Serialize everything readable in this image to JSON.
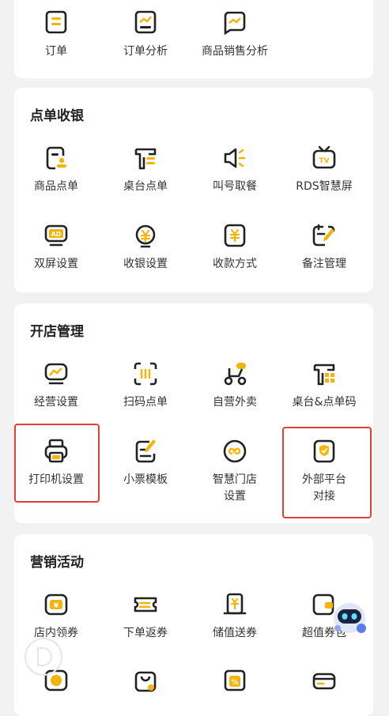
{
  "colors": {
    "accent": "#f5b40a",
    "stroke": "#222222",
    "highlight": "#e0403a"
  },
  "top": {
    "items": [
      {
        "label": "订单",
        "icon": "order-icon"
      },
      {
        "label": "订单分析",
        "icon": "order-analysis-icon"
      },
      {
        "label": "商品销售分析",
        "icon": "sales-analysis-icon"
      }
    ]
  },
  "checkout": {
    "title": "点单收银",
    "items": [
      {
        "label": "商品点单",
        "icon": "goods-order-icon"
      },
      {
        "label": "桌台点单",
        "icon": "table-order-icon"
      },
      {
        "label": "叫号取餐",
        "icon": "speaker-icon"
      },
      {
        "label": "RDS智慧屏",
        "icon": "tv-icon"
      },
      {
        "label": "双屏设置",
        "icon": "ad-screen-icon"
      },
      {
        "label": "收银设置",
        "icon": "cashier-icon"
      },
      {
        "label": "收款方式",
        "icon": "payment-icon"
      },
      {
        "label": "备注管理",
        "icon": "note-icon"
      }
    ]
  },
  "store": {
    "title": "开店管理",
    "items": [
      {
        "label": "经营设置",
        "icon": "business-icon"
      },
      {
        "label": "扫码点单",
        "icon": "scan-icon"
      },
      {
        "label": "自营外卖",
        "icon": "scooter-icon"
      },
      {
        "label": "桌台&点单码",
        "icon": "table-qr-icon"
      },
      {
        "label": "打印机设置",
        "icon": "printer-icon"
      },
      {
        "label": "小票模板",
        "icon": "receipt-icon"
      },
      {
        "label_1": "智慧门店",
        "label_2": "设置",
        "icon": "smart-store-icon"
      },
      {
        "label_1": "外部平台",
        "label_2": "对接",
        "icon": "shield-icon"
      }
    ]
  },
  "marketing": {
    "title": "营销活动",
    "items": [
      {
        "label": "店内领券",
        "icon": "coupon-icon"
      },
      {
        "label": "下单返券",
        "icon": "ticket-icon"
      },
      {
        "label": "储值送券",
        "icon": "stored-value-icon"
      },
      {
        "label": "超值券包",
        "icon": "coupon-pack-icon"
      },
      {
        "icon": "coin-icon"
      },
      {
        "icon": "bag-icon"
      },
      {
        "icon": "discount-icon"
      },
      {
        "icon": "card-icon"
      }
    ]
  }
}
